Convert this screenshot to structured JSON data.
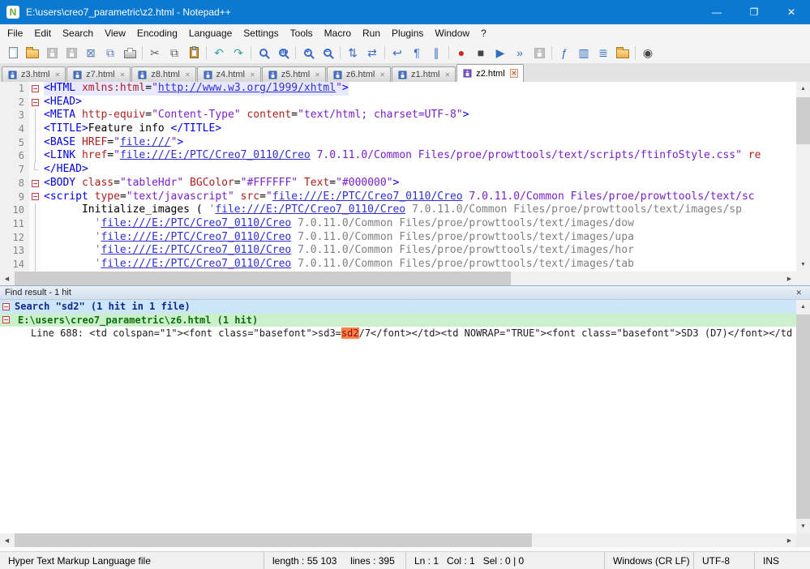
{
  "colors": {
    "titlebar_bg": "#0B79D0",
    "current_line_bg": "#E8E8FF",
    "scrollbar_thumb": "#CDCDCD"
  },
  "window": {
    "title": "E:\\users\\creo7_parametric\\z2.html - Notepad++",
    "app_badge": "N",
    "minimize_glyph": "—",
    "maximize_glyph": "❐",
    "close_glyph": "✕"
  },
  "menubar": {
    "items": [
      "File",
      "Edit",
      "Search",
      "View",
      "Encoding",
      "Language",
      "Settings",
      "Tools",
      "Macro",
      "Run",
      "Plugins",
      "Window",
      "?"
    ]
  },
  "toolbar": {
    "icons": [
      {
        "name": "new-file-icon",
        "kind": "page"
      },
      {
        "name": "open-file-icon",
        "kind": "folder"
      },
      {
        "name": "save-icon",
        "kind": "floppy",
        "disabled": true
      },
      {
        "name": "save-all-icon",
        "kind": "floppy",
        "disabled": true
      },
      {
        "name": "close-file-icon",
        "kind": "glyph",
        "glyph": "⊠",
        "color": "#5B7FBE"
      },
      {
        "name": "close-all-icon",
        "kind": "glyph",
        "glyph": "⧉",
        "color": "#5B7FBE"
      },
      {
        "name": "print-icon",
        "kind": "printer"
      },
      {
        "name": "cut-icon",
        "kind": "glyph",
        "glyph": "✂",
        "color": "#606060",
        "sep": true
      },
      {
        "name": "copy-icon",
        "kind": "glyph",
        "glyph": "⧉",
        "color": "#606060"
      },
      {
        "name": "paste-icon",
        "kind": "clipboard"
      },
      {
        "name": "undo-icon",
        "kind": "glyph",
        "glyph": "↶",
        "color": "#2FA0A8",
        "sep": true
      },
      {
        "name": "redo-icon",
        "kind": "glyph",
        "glyph": "↷",
        "color": "#2FA0A8"
      },
      {
        "name": "find-icon",
        "kind": "mag",
        "sep": true
      },
      {
        "name": "replace-icon",
        "kind": "mag",
        "sign": "ab"
      },
      {
        "name": "zoom-in-icon",
        "kind": "mag",
        "sign": "+",
        "sep": true
      },
      {
        "name": "zoom-out-icon",
        "kind": "mag",
        "sign": "−"
      },
      {
        "name": "sync-vertical-icon",
        "kind": "glyph",
        "glyph": "⇅",
        "color": "#3A6BC8",
        "sep": true
      },
      {
        "name": "sync-horizontal-icon",
        "kind": "glyph",
        "glyph": "⇄",
        "color": "#3A6BC8"
      },
      {
        "name": "word-wrap-icon",
        "kind": "glyph",
        "glyph": "↩",
        "color": "#3A6BC8",
        "sep": true
      },
      {
        "name": "show-all-characters-icon",
        "kind": "glyph",
        "glyph": "¶",
        "color": "#3A6BC8"
      },
      {
        "name": "indent-guide-icon",
        "kind": "glyph",
        "glyph": "∥",
        "color": "#3A6BC8"
      },
      {
        "name": "record-macro-icon",
        "kind": "glyph",
        "glyph": "●",
        "color": "#CC2222",
        "sep": true
      },
      {
        "name": "stop-recording-icon",
        "kind": "glyph",
        "glyph": "■",
        "color": "#444444"
      },
      {
        "name": "playback-macro-icon",
        "kind": "glyph",
        "glyph": "▶",
        "color": "#2F6FBF"
      },
      {
        "name": "run-macro-multiple-icon",
        "kind": "glyph",
        "glyph": "»",
        "color": "#2F6FBF"
      },
      {
        "name": "save-macro-icon",
        "kind": "floppy",
        "disabled": true
      },
      {
        "name": "function-list-icon",
        "kind": "glyph",
        "glyph": "ƒ",
        "color": "#2F6FBF",
        "sep": true
      },
      {
        "name": "document-map-icon",
        "kind": "glyph",
        "glyph": "▥",
        "color": "#2F6FBF"
      },
      {
        "name": "document-list-icon",
        "kind": "glyph",
        "glyph": "≣",
        "color": "#2F6FBF"
      },
      {
        "name": "folder-as-workspace-icon",
        "kind": "folder"
      },
      {
        "name": "monitoring-icon",
        "kind": "glyph",
        "glyph": "◉",
        "color": "#444444",
        "sep": true
      }
    ]
  },
  "tabbar": {
    "tabs": [
      {
        "label": "z3.html",
        "active": false
      },
      {
        "label": "z7.html",
        "active": false
      },
      {
        "label": "z8.html",
        "active": false
      },
      {
        "label": "z4.html",
        "active": false
      },
      {
        "label": "z5.html",
        "active": false
      },
      {
        "label": "z6.html",
        "active": false
      },
      {
        "label": "z1.html",
        "active": false
      },
      {
        "label": "z2.html",
        "active": true
      }
    ]
  },
  "editor": {
    "token_colors": {
      "tag": "#0000E0",
      "att": "#B02020",
      "val": "#7A20C8",
      "url": "#3030D0",
      "str": "#808080",
      "txt": "#000000",
      "pln": "#000000"
    },
    "lines": [
      {
        "num": "1",
        "fold": "open",
        "current": true,
        "seg": [
          [
            "tag",
            "<HTML"
          ],
          [
            "pln",
            " "
          ],
          [
            "att",
            "xmlns:html"
          ],
          [
            "pln",
            "="
          ],
          [
            "val",
            "\""
          ],
          [
            "url",
            "http://www.w3.org/1999/xhtml"
          ],
          [
            "val",
            "\""
          ],
          [
            "tag",
            ">"
          ]
        ]
      },
      {
        "num": "2",
        "fold": "open",
        "seg": [
          [
            "tag",
            "<HEAD>"
          ]
        ]
      },
      {
        "num": "3",
        "fold": "line",
        "seg": [
          [
            "tag",
            "<META"
          ],
          [
            "pln",
            " "
          ],
          [
            "att",
            "http-equiv"
          ],
          [
            "pln",
            "="
          ],
          [
            "val",
            "\"Content-Type\""
          ],
          [
            "pln",
            " "
          ],
          [
            "att",
            "content"
          ],
          [
            "pln",
            "="
          ],
          [
            "val",
            "\"text/html; charset=UTF-8\""
          ],
          [
            "tag",
            ">"
          ]
        ]
      },
      {
        "num": "4",
        "fold": "line",
        "seg": [
          [
            "tag",
            "<TITLE>"
          ],
          [
            "txt",
            "Feature info "
          ],
          [
            "tag",
            "</TITLE>"
          ]
        ]
      },
      {
        "num": "5",
        "fold": "line",
        "seg": [
          [
            "tag",
            "<BASE"
          ],
          [
            "pln",
            " "
          ],
          [
            "att",
            "HREF"
          ],
          [
            "pln",
            "="
          ],
          [
            "val",
            "\""
          ],
          [
            "url",
            "file:///"
          ],
          [
            "val",
            "\""
          ],
          [
            "tag",
            ">"
          ]
        ]
      },
      {
        "num": "6",
        "fold": "line",
        "seg": [
          [
            "tag",
            "<LINK"
          ],
          [
            "pln",
            " "
          ],
          [
            "att",
            "href"
          ],
          [
            "pln",
            "="
          ],
          [
            "val",
            "\""
          ],
          [
            "url",
            "file:///E:/PTC/Creo7_0110/Creo"
          ],
          [
            "val",
            " 7.0.11.0/Common Files/proe/prowttools/text/scripts/ftinfoStyle.css\""
          ],
          [
            "pln",
            " "
          ],
          [
            "att",
            "re"
          ]
        ]
      },
      {
        "num": "7",
        "fold": "end",
        "seg": [
          [
            "tag",
            "</HEAD>"
          ]
        ]
      },
      {
        "num": "8",
        "fold": "open",
        "seg": [
          [
            "tag",
            "<BODY"
          ],
          [
            "pln",
            " "
          ],
          [
            "att",
            "class"
          ],
          [
            "pln",
            "="
          ],
          [
            "val",
            "\"tableHdr\""
          ],
          [
            "pln",
            " "
          ],
          [
            "att",
            "BGColor"
          ],
          [
            "pln",
            "="
          ],
          [
            "val",
            "\"#FFFFFF\""
          ],
          [
            "pln",
            " "
          ],
          [
            "att",
            "Text"
          ],
          [
            "pln",
            "="
          ],
          [
            "val",
            "\"#000000\""
          ],
          [
            "tag",
            ">"
          ]
        ]
      },
      {
        "num": "9",
        "fold": "open",
        "seg": [
          [
            "tag",
            "<script"
          ],
          [
            "pln",
            " "
          ],
          [
            "att",
            "type"
          ],
          [
            "pln",
            "="
          ],
          [
            "val",
            "\"text/javascript\""
          ],
          [
            "pln",
            " "
          ],
          [
            "att",
            "src"
          ],
          [
            "pln",
            "="
          ],
          [
            "val",
            "\""
          ],
          [
            "url",
            "file:///E:/PTC/Creo7_0110/Creo"
          ],
          [
            "val",
            " 7.0.11.0/Common Files/proe/prowttools/text/sc"
          ]
        ]
      },
      {
        "num": "10",
        "fold": "line",
        "seg": [
          [
            "pln",
            "      Initialize_images ( "
          ],
          [
            "str",
            "'"
          ],
          [
            "url",
            "file:///E:/PTC/Creo7_0110/Creo"
          ],
          [
            "str",
            " 7.0.11.0/Common Files/proe/prowttools/text/images/sp"
          ]
        ]
      },
      {
        "num": "11",
        "fold": "line",
        "seg": [
          [
            "pln",
            "        "
          ],
          [
            "str",
            "'"
          ],
          [
            "url",
            "file:///E:/PTC/Creo7_0110/Creo"
          ],
          [
            "str",
            " 7.0.11.0/Common Files/proe/prowttools/text/images/dow"
          ]
        ]
      },
      {
        "num": "12",
        "fold": "line",
        "seg": [
          [
            "pln",
            "        "
          ],
          [
            "str",
            "'"
          ],
          [
            "url",
            "file:///E:/PTC/Creo7_0110/Creo"
          ],
          [
            "str",
            " 7.0.11.0/Common Files/proe/prowttools/text/images/upa"
          ]
        ]
      },
      {
        "num": "13",
        "fold": "line",
        "seg": [
          [
            "pln",
            "        "
          ],
          [
            "str",
            "'"
          ],
          [
            "url",
            "file:///E:/PTC/Creo7_0110/Creo"
          ],
          [
            "str",
            " 7.0.11.0/Common Files/proe/prowttools/text/images/hor"
          ]
        ]
      },
      {
        "num": "14",
        "fold": "line",
        "seg": [
          [
            "pln",
            "        "
          ],
          [
            "str",
            "'"
          ],
          [
            "url",
            "file:///E:/PTC/Creo7_0110/Creo"
          ],
          [
            "str",
            " 7.0.11.0/Common Files/proe/prowttools/text/images/tab"
          ]
        ]
      }
    ]
  },
  "find_panel": {
    "title": "Find result - 1 hit",
    "close_glyph": "✕",
    "search_line": "Search \"sd2\" (1 hit in 1 file)",
    "file_line": "E:\\users\\creo7_parametric\\z6.html (1 hit)",
    "hit_prefix": "Line 688: ",
    "hit_before": "<td colspan=\"1\"><font class=\"basefont\">sd3=",
    "hit_match": "sd2",
    "hit_after": "/7</font></td><td NOWRAP=\"TRUE\"><font class=\"basefont\">SD3 (D7)</font></td",
    "colors": {
      "search_bg": "#CDE6F7",
      "search_fg": "#10288F",
      "file_bg": "#CCF0CC",
      "file_fg": "#0E700E",
      "match_bg": "#FF8048",
      "match_fg": "#7F1000"
    }
  },
  "statusbar": {
    "doc_type": "Hyper Text Markup Language file",
    "length_info": "length : 55 103     lines : 395",
    "cursor_info": "Ln : 1   Col : 1   Sel : 0 | 0",
    "eol_format": "Windows (CR LF)",
    "encoding": "UTF-8",
    "insert_mode": "INS"
  }
}
